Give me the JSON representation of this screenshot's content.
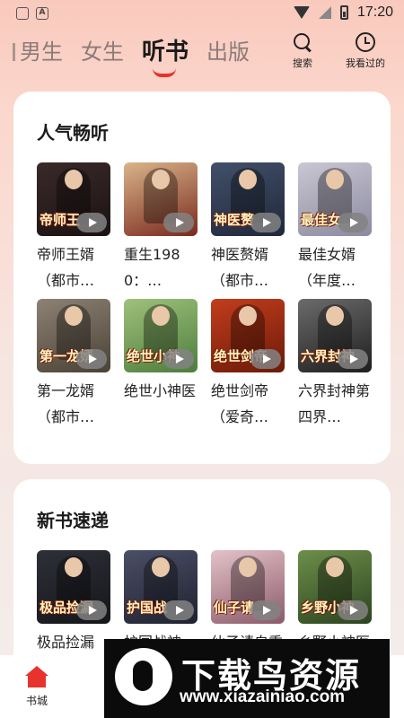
{
  "status_bar": {
    "time": "17:20",
    "app_badge": "A",
    "colors": {
      "text": "#222222"
    }
  },
  "header": {
    "tabs": [
      {
        "label": "男生",
        "active": false
      },
      {
        "label": "女生",
        "active": false
      },
      {
        "label": "听书",
        "active": true
      },
      {
        "label": "出版",
        "active": false
      }
    ],
    "search_label": "搜索",
    "history_label": "我看过的",
    "accent": "#e8322d"
  },
  "sections": [
    {
      "title": "人气畅听",
      "books": [
        {
          "title": "帝师王婿（都市…",
          "cover_text": "帝师王",
          "cover_colors": [
            "#3a2a2a",
            "#1b1212"
          ]
        },
        {
          "title": "重生1980：…",
          "cover_text": "",
          "cover_colors": [
            "#d9b48a",
            "#7a2a1e"
          ]
        },
        {
          "title": "神医赘婿（都市…",
          "cover_text": "神医赘",
          "cover_colors": [
            "#42506a",
            "#20283a"
          ]
        },
        {
          "title": "最佳女婿（年度…",
          "cover_text": "最佳女",
          "cover_colors": [
            "#c9c7d2",
            "#8b8aa0"
          ]
        },
        {
          "title": "第一龙婿（都市…",
          "cover_text": "第一龙婿",
          "cover_colors": [
            "#8d8273",
            "#4a4237"
          ]
        },
        {
          "title": "绝世小神医",
          "cover_text": "绝世小神",
          "cover_colors": [
            "#9fc17b",
            "#4d7d3c"
          ]
        },
        {
          "title": "绝世剑帝（爱奇…",
          "cover_text": "绝世剑帝",
          "cover_colors": [
            "#c33d1d",
            "#6b1a08"
          ]
        },
        {
          "title": "六界封神第四界…",
          "cover_text": "六界封神",
          "cover_colors": [
            "#6b6b6b",
            "#1e1e1e"
          ]
        }
      ]
    },
    {
      "title": "新书速递",
      "books": [
        {
          "title": "极品捡漏",
          "cover_text": "极品捡漏",
          "cover_colors": [
            "#2e3038",
            "#15161a"
          ]
        },
        {
          "title": "护国战神",
          "cover_text": "护国战",
          "cover_colors": [
            "#4b4f66",
            "#1f2230"
          ]
        },
        {
          "title": "仙子请自重",
          "cover_text": "仙子请",
          "cover_colors": [
            "#e3c2c8",
            "#8c5a6a"
          ]
        },
        {
          "title": "乡野小神医",
          "cover_text": "乡野小神",
          "cover_colors": [
            "#6d8e4a",
            "#2c4420"
          ]
        }
      ]
    }
  ],
  "bottom_nav": {
    "home_label": "书城",
    "home_icon": "home-icon"
  },
  "watermark": {
    "title": "下载鸟资源",
    "url": "www.xiazainiao.com"
  }
}
